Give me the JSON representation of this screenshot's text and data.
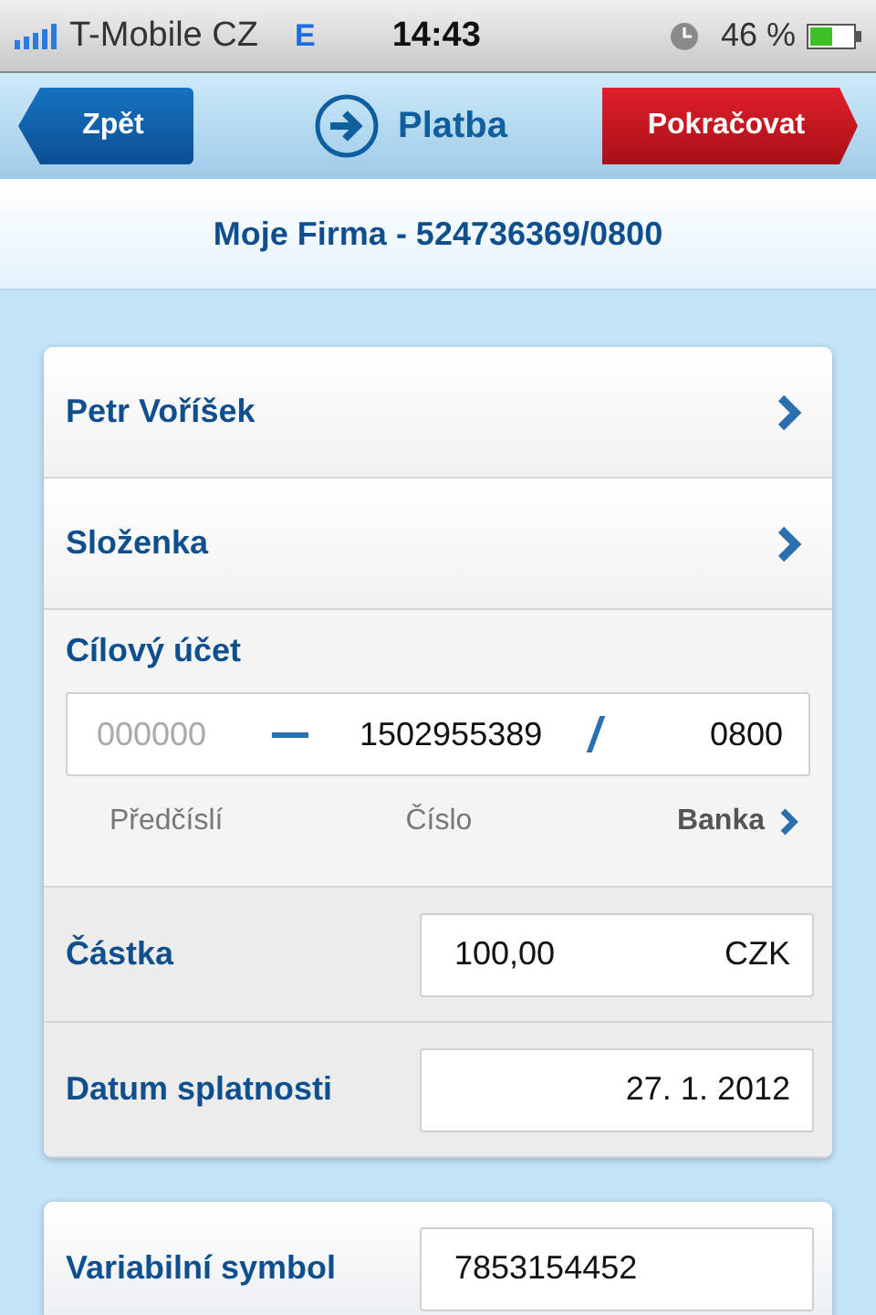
{
  "status_bar": {
    "carrier": "T-Mobile CZ",
    "network": "E",
    "time": "14:43",
    "battery": "46 %"
  },
  "nav": {
    "back": "Zpět",
    "title": "Platba",
    "next": "Pokračovat"
  },
  "header": "Moje Firma - 524736369/0800",
  "rows": [
    {
      "kind": "link",
      "label": "Petr Voříšek"
    },
    {
      "kind": "link",
      "label": "Složenka"
    },
    {
      "kind": "account",
      "label": "Cílový účet",
      "prefix_placeholder": "000000",
      "number": "1502955389",
      "bank_code": "0800",
      "prefix_caption": "Předčíslí",
      "number_caption": "Číslo",
      "bank_caption": "Banka"
    },
    {
      "kind": "amount",
      "label": "Částka",
      "value": "100,00",
      "currency": "CZK"
    },
    {
      "kind": "field",
      "label": "Datum splatnosti",
      "value": "27. 1. 2012"
    }
  ],
  "extra_rows": [
    {
      "kind": "field",
      "label": "Variabilní symbol",
      "value": "7853154452"
    }
  ]
}
